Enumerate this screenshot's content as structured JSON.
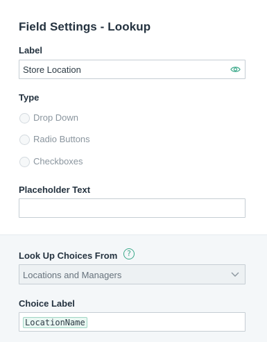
{
  "panel": {
    "title": "Field Settings - Lookup"
  },
  "label_section": {
    "heading": "Label",
    "value": "Store Location",
    "visibility_icon": "eye-icon"
  },
  "type_section": {
    "heading": "Type",
    "options": [
      {
        "label": "Drop Down",
        "selected": false
      },
      {
        "label": "Radio Buttons",
        "selected": false
      },
      {
        "label": "Checkboxes",
        "selected": false
      }
    ]
  },
  "placeholder_section": {
    "heading": "Placeholder Text",
    "value": ""
  },
  "lookup_section": {
    "heading": "Look Up Choices From",
    "help_icon": "help-icon",
    "help_glyph": "?",
    "selected": "Locations and Managers"
  },
  "choice_label_section": {
    "heading": "Choice Label",
    "token": "LocationName"
  },
  "colors": {
    "accent": "#3aa889",
    "lower_panel_bg": "#f4f7f9",
    "heading_text": "#24323f",
    "disabled_text": "#8a959e"
  }
}
